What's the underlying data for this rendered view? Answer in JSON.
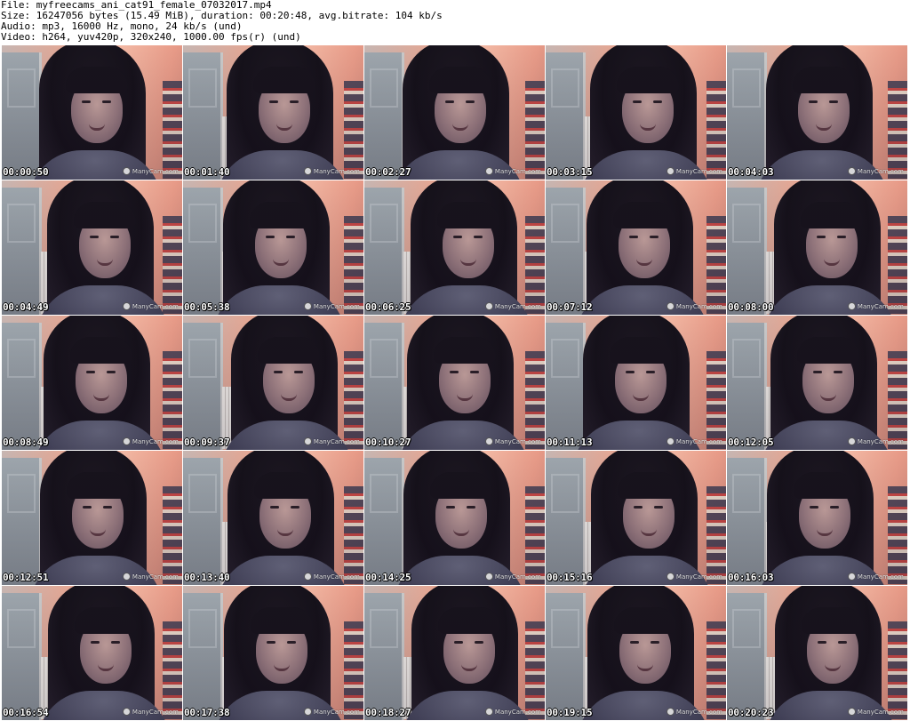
{
  "header": {
    "lines": [
      "File: myfreecams_ani_cat91_female_07032017.mp4",
      "Size: 16247056 bytes (15.49 MiB), duration: 00:20:48, avg.bitrate: 104 kb/s",
      "Audio: mp3, 16000 Hz, mono, 24 kb/s (und)",
      "Video: h264, yuv420p, 320x240, 1000.00 fps(r) (und)"
    ]
  },
  "watermark_text": "ManyCam.com",
  "thumbnails": [
    "00:00:50",
    "00:01:40",
    "00:02:27",
    "00:03:15",
    "00:04:03",
    "00:04:49",
    "00:05:38",
    "00:06:25",
    "00:07:12",
    "00:08:00",
    "00:08:49",
    "00:09:37",
    "00:10:27",
    "00:11:13",
    "00:12:05",
    "00:12:51",
    "00:13:40",
    "00:14:25",
    "00:15:16",
    "00:16:03",
    "00:16:54",
    "00:17:38",
    "00:18:27",
    "00:19:15",
    "00:20:23"
  ]
}
